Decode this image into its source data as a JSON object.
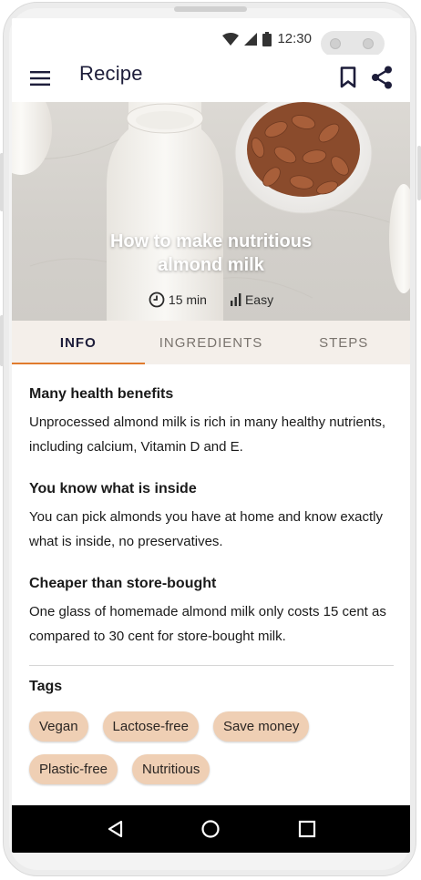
{
  "status_bar": {
    "time": "12:30"
  },
  "app_bar": {
    "title": "Recipe"
  },
  "hero": {
    "title_line1": "How to make nutritious",
    "title_line2": "almond milk",
    "duration": "15 min",
    "difficulty": "Easy"
  },
  "tabs": [
    {
      "label": "INFO",
      "active": true
    },
    {
      "label": "INGREDIENTS",
      "active": false
    },
    {
      "label": "STEPS",
      "active": false
    }
  ],
  "sections": [
    {
      "heading": "Many health benefits",
      "body": "Unprocessed almond milk is rich in many healthy nutrients, including calcium, Vitamin D and E."
    },
    {
      "heading": "You know what is inside",
      "body": "You can pick almonds you have at home and know exactly what is inside, no preservatives."
    },
    {
      "heading": "Cheaper than store-bought",
      "body": "One glass of homemade almond milk only costs 15 cent as compared to 30 cent for store-bought milk."
    }
  ],
  "tags": {
    "label": "Tags",
    "items": [
      "Vegan",
      "Lactose-free",
      "Save money",
      "Plastic-free",
      "Nutritious"
    ]
  },
  "colors": {
    "accent": "#e07b2d",
    "chip": "#efcfb4",
    "tab_bg": "#f4efea",
    "title": "#1d1d3a"
  },
  "icons": [
    "menu-icon",
    "bookmark-icon",
    "share-icon",
    "clock-icon",
    "bars-icon",
    "back-icon",
    "home-icon",
    "recents-icon",
    "wifi-icon",
    "signal-icon",
    "battery-icon"
  ]
}
